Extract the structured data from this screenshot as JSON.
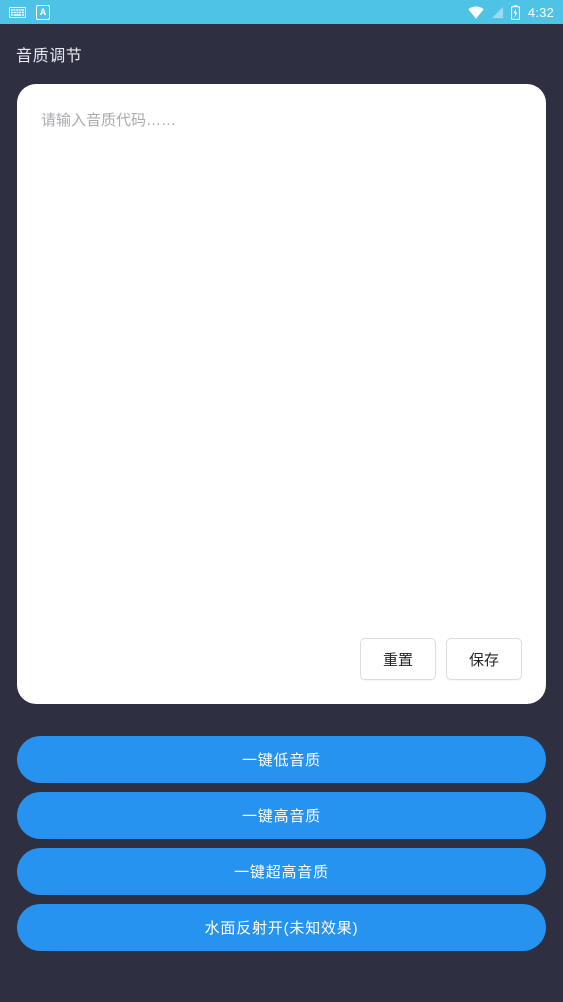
{
  "status_bar": {
    "background": "#4fc3e6",
    "left_icons": [
      {
        "name": "keyboard-icon",
        "label": "keyboard"
      },
      {
        "name": "ime-icon",
        "label": "A"
      }
    ],
    "right_icons": [
      {
        "name": "wifi-icon",
        "label": "wifi"
      },
      {
        "name": "signal-icon",
        "label": "signal"
      },
      {
        "name": "battery-charging-icon",
        "label": "battery charging"
      }
    ],
    "time": "4:32"
  },
  "app_bar": {
    "title": "音质调节",
    "background": "#2e3042",
    "text_color": "#e8e9ef"
  },
  "editor_card": {
    "background": "#ffffff",
    "input": {
      "value": "",
      "placeholder": "请输入音质代码……"
    },
    "reset_label": "重置",
    "save_label": "保存"
  },
  "actions": {
    "accent_color": "#2693f0",
    "buttons": [
      {
        "label": "一键低音质",
        "name": "preset-low-quality-button"
      },
      {
        "label": "一键高音质",
        "name": "preset-high-quality-button"
      },
      {
        "label": "一键超高音质",
        "name": "preset-ultra-quality-button"
      },
      {
        "label": "水面反射开(未知效果)",
        "name": "water-reflection-button"
      }
    ]
  }
}
